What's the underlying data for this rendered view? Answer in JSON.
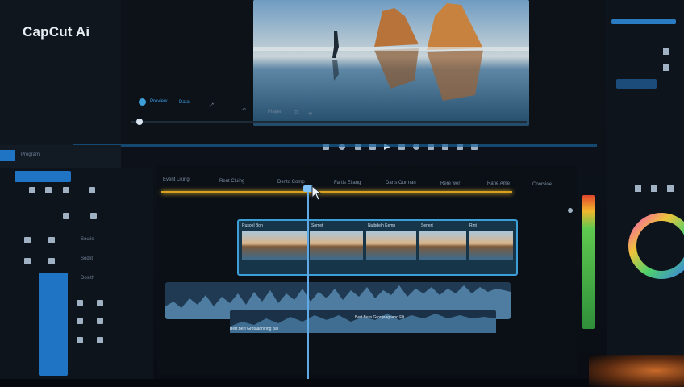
{
  "brand": {
    "logo": "CapCut Ai"
  },
  "preview": {
    "controls": {
      "preview_label": "Preview",
      "tab_label": "Data",
      "player_label": "Player"
    }
  },
  "timeline": {
    "ruler_labels": [
      "Event Liking",
      "Rent Cluing",
      "Dento Comp",
      "Fartis Ellang",
      "Darts Ourman",
      "Rere wer",
      "Rane Ame",
      "Coorsioe"
    ],
    "clip_captions": [
      "Rusoel Bon",
      "Somet",
      "Nuibdelh Eemp",
      "Senert",
      "Rint"
    ],
    "audio_captions": [
      "Bert Bert Grotaadhinng Bal",
      "Bert Bern Gronjaagtiand Elt"
    ]
  },
  "left_panel": {
    "tab_label": "Program",
    "items": [
      "Soulie",
      "Sodiit",
      "Dosith"
    ]
  },
  "colors": {
    "accent": "#3d9fd8",
    "ruler": "#d6a21d",
    "meter_top": "#e2462d",
    "meter_bottom": "#2f8f3a"
  }
}
